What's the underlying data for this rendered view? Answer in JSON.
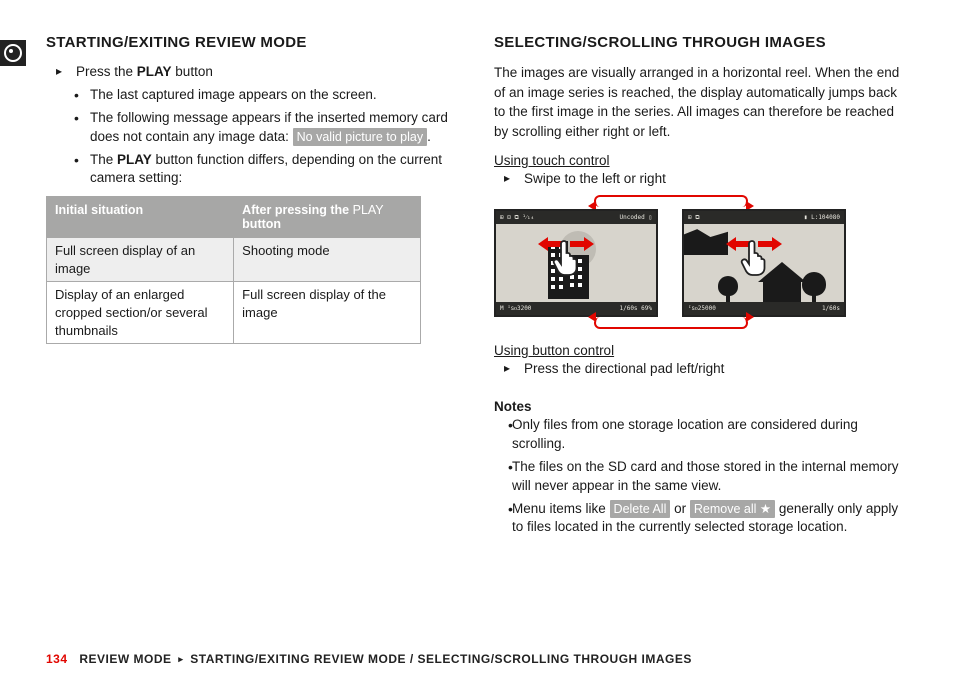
{
  "left": {
    "heading": "STARTING/EXITING REVIEW MODE",
    "step1_pre": "Press the ",
    "play_word": "PLAY",
    "step1_post": " button",
    "b1": "The last captured image appears on the screen.",
    "b2_pre": "The following message appears if the inserted memory card does not contain any image data: ",
    "b2_chip": "No valid picture to play",
    "b2_post": ".",
    "b3_pre": "The ",
    "b3_post": " button function differs, depending on the current camera setting:",
    "table": {
      "h1": "Initial situation",
      "h2_pre": "After pressing the ",
      "h2_thin": "PLAY",
      "h2_post": " button",
      "rows": [
        [
          "Full screen display of an image",
          "Shooting mode"
        ],
        [
          "Display of an enlarged cropped section/or several thumbnails",
          "Full screen display of the image"
        ]
      ]
    }
  },
  "right": {
    "heading": "SELECTING/SCROLLING THROUGH IMAGES",
    "para": "The images are visually arranged in a horizontal reel. When the end of an image series is reached, the display automatically jumps back to the first image in the series. All images can therefore be reached by scrolling either right or left.",
    "touch_h": "Using touch control",
    "touch_step": "Swipe to the left or right",
    "button_h": "Using button control",
    "button_step": "Press the directional pad left/right",
    "notes_h": "Notes",
    "n1": "Only files from one storage location are considered during scrolling.",
    "n2": "The files on the SD card and those stored in the internal memory will never appear in the same view.",
    "n3_pre": "Menu items like ",
    "n3_chip1": "Delete All",
    "n3_mid": " or ",
    "n3_chip2": "Remove all ★",
    "n3_post": " generally only apply to files located in the currently selected storage location."
  },
  "illus": {
    "left_top_l": "⊞ ⊡ ⧉ ¹⁄₁₄",
    "left_top_r": "Uncoded ▯",
    "left_bot_l": "M    ᴵꜱᴏ3200",
    "left_bot_r": "1/60s    69%",
    "right_top_l": "⊞ ⧉",
    "right_top_r": "▮ L:104080",
    "right_bot_l": "    ᴵꜱᴏ25000",
    "right_bot_r": "1/60s"
  },
  "footer": {
    "page": "134",
    "crumb1": "REVIEW MODE",
    "crumb2": "STARTING/EXITING REVIEW MODE  /  SELECTING/SCROLLING THROUGH IMAGES"
  }
}
